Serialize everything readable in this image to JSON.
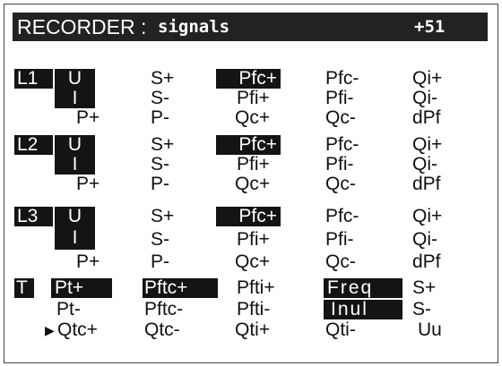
{
  "title": {
    "name": "RECORDER :",
    "file": "signals",
    "count": "+51"
  },
  "groups": [
    {
      "label": "L1",
      "rows": [
        [
          "U",
          "S+",
          "Pfc+",
          "Pfc-",
          "Qi+"
        ],
        [
          "I",
          "S-",
          "Pfi+",
          "Pfi-",
          "Qi-"
        ],
        [
          "P+",
          "P-",
          "Qc+",
          "Qc-",
          "dPf"
        ]
      ]
    },
    {
      "label": "L2",
      "rows": [
        [
          "U",
          "S+",
          "Pfc+",
          "Pfc-",
          "Qi+"
        ],
        [
          "I",
          "S-",
          "Pfi+",
          "Pfi-",
          "Qi-"
        ],
        [
          "P+",
          "P-",
          "Qc+",
          "Qc-",
          "dPf"
        ]
      ]
    },
    {
      "label": "L3",
      "rows": [
        [
          "U",
          "S+",
          "Pfc+",
          "Pfc-",
          "Qi+"
        ],
        [
          "I",
          "S-",
          "Pfi+",
          "Pfi-",
          "Qi-"
        ],
        [
          "P+",
          "P-",
          "Qc+",
          "Qc-",
          "dPf"
        ]
      ]
    }
  ],
  "total": {
    "label": "T",
    "rows": [
      [
        "Pt+",
        "Pftc+",
        "Pfti+",
        "Freq",
        "S+"
      ],
      [
        "Pt-",
        "Pftc-",
        "Pfti-",
        "Inul",
        "S-"
      ],
      [
        "Qtc+",
        "Qtc-",
        "Qti+",
        "Qti-",
        "Uu"
      ]
    ]
  },
  "cursor": "▶"
}
